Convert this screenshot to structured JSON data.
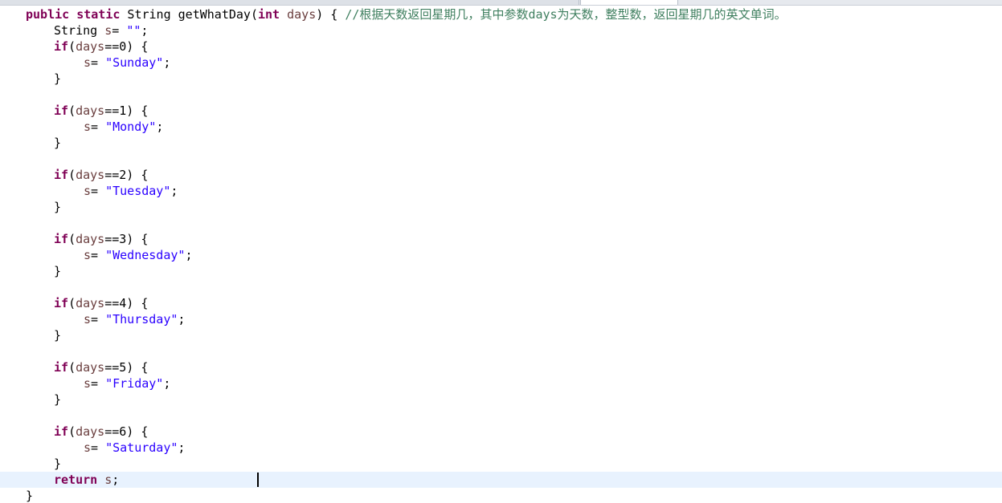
{
  "code": {
    "lines": [
      [
        {
          "k": "kw",
          "t": "public"
        },
        {
          "k": "plain",
          "t": " "
        },
        {
          "k": "kw",
          "t": "static"
        },
        {
          "k": "plain",
          "t": " String getWhatDay("
        },
        {
          "k": "kw",
          "t": "int"
        },
        {
          "k": "plain",
          "t": " "
        },
        {
          "k": "var",
          "t": "days"
        },
        {
          "k": "plain",
          "t": ") { "
        },
        {
          "k": "cmt",
          "t": "//根据天数返回星期几，其中参数days为天数，整型数，返回星期几的英文单词。"
        }
      ],
      [
        {
          "k": "plain",
          "t": "String "
        },
        {
          "k": "var",
          "t": "s"
        },
        {
          "k": "plain",
          "t": "= "
        },
        {
          "k": "str",
          "t": "\"\""
        },
        {
          "k": "plain",
          "t": ";"
        }
      ],
      [
        {
          "k": "kw",
          "t": "if"
        },
        {
          "k": "plain",
          "t": "("
        },
        {
          "k": "var",
          "t": "days"
        },
        {
          "k": "plain",
          "t": "==0) {"
        }
      ],
      [
        {
          "k": "var",
          "t": "s"
        },
        {
          "k": "plain",
          "t": "= "
        },
        {
          "k": "str",
          "t": "\"Sunday\""
        },
        {
          "k": "plain",
          "t": ";"
        }
      ],
      [
        {
          "k": "plain",
          "t": "}"
        }
      ],
      [],
      [
        {
          "k": "kw",
          "t": "if"
        },
        {
          "k": "plain",
          "t": "("
        },
        {
          "k": "var",
          "t": "days"
        },
        {
          "k": "plain",
          "t": "==1) {"
        }
      ],
      [
        {
          "k": "var",
          "t": "s"
        },
        {
          "k": "plain",
          "t": "= "
        },
        {
          "k": "str",
          "t": "\"Mondy\""
        },
        {
          "k": "plain",
          "t": ";"
        }
      ],
      [
        {
          "k": "plain",
          "t": "}"
        }
      ],
      [],
      [
        {
          "k": "kw",
          "t": "if"
        },
        {
          "k": "plain",
          "t": "("
        },
        {
          "k": "var",
          "t": "days"
        },
        {
          "k": "plain",
          "t": "==2) {"
        }
      ],
      [
        {
          "k": "var",
          "t": "s"
        },
        {
          "k": "plain",
          "t": "= "
        },
        {
          "k": "str",
          "t": "\"Tuesday\""
        },
        {
          "k": "plain",
          "t": ";"
        }
      ],
      [
        {
          "k": "plain",
          "t": "}"
        }
      ],
      [],
      [
        {
          "k": "kw",
          "t": "if"
        },
        {
          "k": "plain",
          "t": "("
        },
        {
          "k": "var",
          "t": "days"
        },
        {
          "k": "plain",
          "t": "==3) {"
        }
      ],
      [
        {
          "k": "var",
          "t": "s"
        },
        {
          "k": "plain",
          "t": "= "
        },
        {
          "k": "str",
          "t": "\"Wednesday\""
        },
        {
          "k": "plain",
          "t": ";"
        }
      ],
      [
        {
          "k": "plain",
          "t": "}"
        }
      ],
      [],
      [
        {
          "k": "kw",
          "t": "if"
        },
        {
          "k": "plain",
          "t": "("
        },
        {
          "k": "var",
          "t": "days"
        },
        {
          "k": "plain",
          "t": "==4) {"
        }
      ],
      [
        {
          "k": "var",
          "t": "s"
        },
        {
          "k": "plain",
          "t": "= "
        },
        {
          "k": "str",
          "t": "\"Thursday\""
        },
        {
          "k": "plain",
          "t": ";"
        }
      ],
      [
        {
          "k": "plain",
          "t": "}"
        }
      ],
      [],
      [
        {
          "k": "kw",
          "t": "if"
        },
        {
          "k": "plain",
          "t": "("
        },
        {
          "k": "var",
          "t": "days"
        },
        {
          "k": "plain",
          "t": "==5) {"
        }
      ],
      [
        {
          "k": "var",
          "t": "s"
        },
        {
          "k": "plain",
          "t": "= "
        },
        {
          "k": "str",
          "t": "\"Friday\""
        },
        {
          "k": "plain",
          "t": ";"
        }
      ],
      [
        {
          "k": "plain",
          "t": "}"
        }
      ],
      [],
      [
        {
          "k": "kw",
          "t": "if"
        },
        {
          "k": "plain",
          "t": "("
        },
        {
          "k": "var",
          "t": "days"
        },
        {
          "k": "plain",
          "t": "==6) {"
        }
      ],
      [
        {
          "k": "var",
          "t": "s"
        },
        {
          "k": "plain",
          "t": "= "
        },
        {
          "k": "str",
          "t": "\"Saturday\""
        },
        {
          "k": "plain",
          "t": ";"
        }
      ],
      [
        {
          "k": "plain",
          "t": "}"
        }
      ],
      [
        {
          "k": "kw",
          "t": "return"
        },
        {
          "k": "plain",
          "t": " "
        },
        {
          "k": "var",
          "t": "s"
        },
        {
          "k": "plain",
          "t": ";"
        }
      ],
      [
        {
          "k": "plain",
          "t": "}"
        }
      ]
    ]
  },
  "colors": {
    "keyword": "#7f0055",
    "string": "#2a00ff",
    "comment": "#3f7f5f",
    "variable": "#6a3e3e",
    "current_line": "#e8f2fe"
  }
}
